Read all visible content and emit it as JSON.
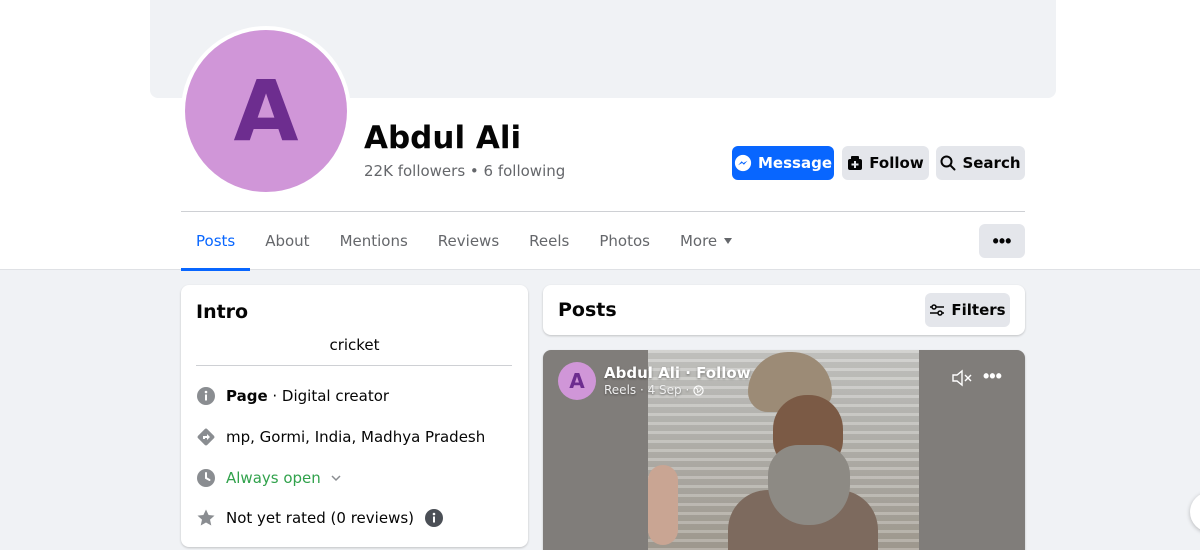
{
  "profile": {
    "avatar_letter": "A",
    "name": "Abdul Ali",
    "stats": "22K followers • 6 following"
  },
  "actions": {
    "message": "Message",
    "follow": "Follow",
    "search": "Search"
  },
  "tabs": [
    {
      "label": "Posts",
      "active": true
    },
    {
      "label": "About"
    },
    {
      "label": "Mentions"
    },
    {
      "label": "Reviews"
    },
    {
      "label": "Reels"
    },
    {
      "label": "Photos"
    },
    {
      "label": "More"
    }
  ],
  "intro": {
    "title": "Intro",
    "bio": "cricket",
    "page_label": "Page",
    "page_category": " · Digital creator",
    "location": "mp, Gormi, India, Madhya Pradesh",
    "hours": "Always open",
    "rating": "Not yet rated (0 reviews)"
  },
  "posts": {
    "title": "Posts",
    "filters": "Filters",
    "post": {
      "avatar_letter": "A",
      "author": "Abdul Ali · Follow",
      "meta": "Reels · 4 Sep ·"
    }
  },
  "colors": {
    "accent": "#0866ff",
    "avatar_bg": "#d096d8",
    "avatar_fg": "#6d2d8f",
    "hours_green": "#31a24c"
  }
}
